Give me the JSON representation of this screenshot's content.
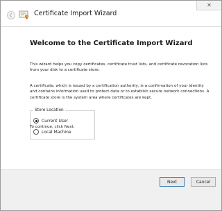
{
  "window": {
    "title": "Certificate Import Wizard",
    "close_glyph": "✕"
  },
  "main": {
    "heading": "Welcome to the Certificate Import Wizard",
    "paragraph1": "This wizard helps you copy certificates, certificate trust lists, and certificate revocation lists from your disk to a certificate store.",
    "paragraph2": "A certificate, which is issued by a certification authority, is a confirmation of your identity and contains information used to protect data or to establish secure network connections. A certificate store is the system area where certificates are kept.",
    "store_location": {
      "legend": "Store Location",
      "options": [
        {
          "label": "Current User",
          "selected": true
        },
        {
          "label": "Local Machine",
          "selected": false
        }
      ]
    },
    "continue_hint": "To continue, click Next."
  },
  "footer": {
    "next_label": "Next",
    "cancel_label": "Cancel"
  },
  "colors": {
    "accent_border": "#3c7fb1",
    "footer_bg": "#f0f0f0"
  },
  "icons": {
    "back": "back-arrow-icon",
    "app": "certificate-icon",
    "close": "close-icon"
  }
}
